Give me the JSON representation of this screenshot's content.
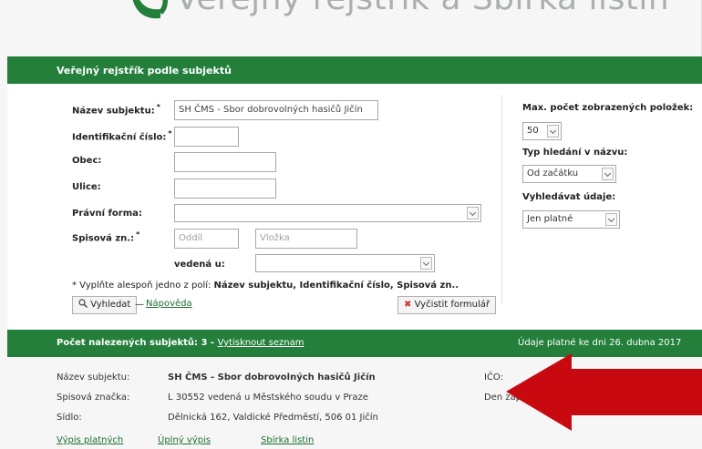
{
  "header": {
    "site_title": "Veřejný rejstřík a Sbírka listin"
  },
  "form_section": {
    "title": "Veřejný rejstřík podle subjektů",
    "fields": {
      "name_label": "Název subjektu:",
      "name_value": "SH ČMS - Sbor dobrovolných hasičů Jičín",
      "ico_label": "Identifikační číslo:",
      "ico_value": "",
      "obec_label": "Obec:",
      "obec_value": "",
      "ulice_label": "Ulice:",
      "ulice_value": "",
      "pravni_forma_label": "Právní forma:",
      "pravni_forma_value": "",
      "spisova_zn_label": "Spisová zn.:",
      "oddil_placeholder": "Oddíl",
      "vlozka_placeholder": "Vložka",
      "vedena_label": "vedená u:",
      "vedena_value": ""
    },
    "required_mark": "*",
    "required_note_prefix": "* Vyplňte alespoň jedno z polí: ",
    "required_note_fields": "Název subjektu, Identifikační číslo, Spisová zn..",
    "search_button": "Vyhledat",
    "dash": "—",
    "help_link": "Nápověda",
    "clear_button": "Vyčistit formulář",
    "options": {
      "max_count_label": "Max. počet zobrazených položek:",
      "max_count_value": "50",
      "search_type_label": "Typ hledání v názvu:",
      "search_type_value": "Od začátku",
      "search_data_label": "Vyhledávat údaje:",
      "search_data_value": "Jen platné"
    }
  },
  "results": {
    "count_label": "Počet nalezených subjektů: 3 - ",
    "print_link": "Vytisknout seznam",
    "valid_date": "Údaje platné ke dni 26. dubna 2017",
    "item": {
      "name_label": "Název subjektu:",
      "name_value": "SH ČMS - Sbor dobrovolných hasičů Jičín",
      "spis_label": "Spisová značka:",
      "spis_value": "L 30552 vedená u Městského soudu v Praze",
      "sidlo_label": "Sídlo:",
      "sidlo_value": "Dělnická 162, Valdické Předměstí, 506 01 Jičín",
      "ico_label": "IČO:",
      "zapis_label": "Den zápisu:",
      "links": [
        "Výpis platných",
        "Úplný výpis",
        "Sbírka listin"
      ]
    }
  },
  "overlay": {
    "arrow_color": "#c80a10"
  }
}
